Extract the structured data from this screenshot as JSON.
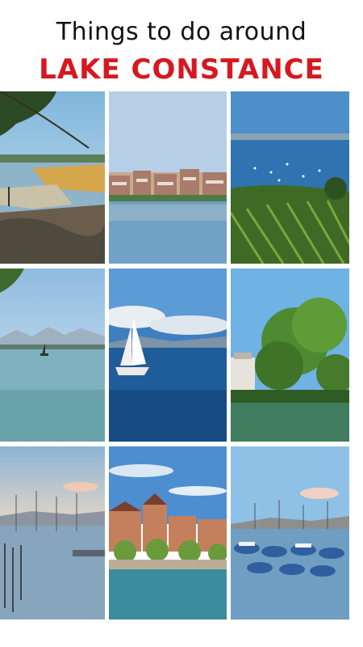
{
  "header": {
    "line1": "Things to do around",
    "line2": "LAKE CONSTANCE",
    "accent_color": "#d6181f"
  },
  "grid": {
    "rows": 3,
    "cols": 3,
    "tiles": [
      {
        "scene": "reedy-shore-with-tree-branch"
      },
      {
        "scene": "lakeside-town-with-reflection"
      },
      {
        "scene": "vineyard-above-lake-with-boats"
      },
      {
        "scene": "calm-lake-with-alps-and-sailboat"
      },
      {
        "scene": "white-sailboat-on-blue-lake"
      },
      {
        "scene": "lush-tree-and-building-by-water"
      },
      {
        "scene": "marina-masts-at-dusk"
      },
      {
        "scene": "historic-buildings-on-promenade"
      },
      {
        "scene": "harbor-with-covered-boats"
      }
    ]
  }
}
